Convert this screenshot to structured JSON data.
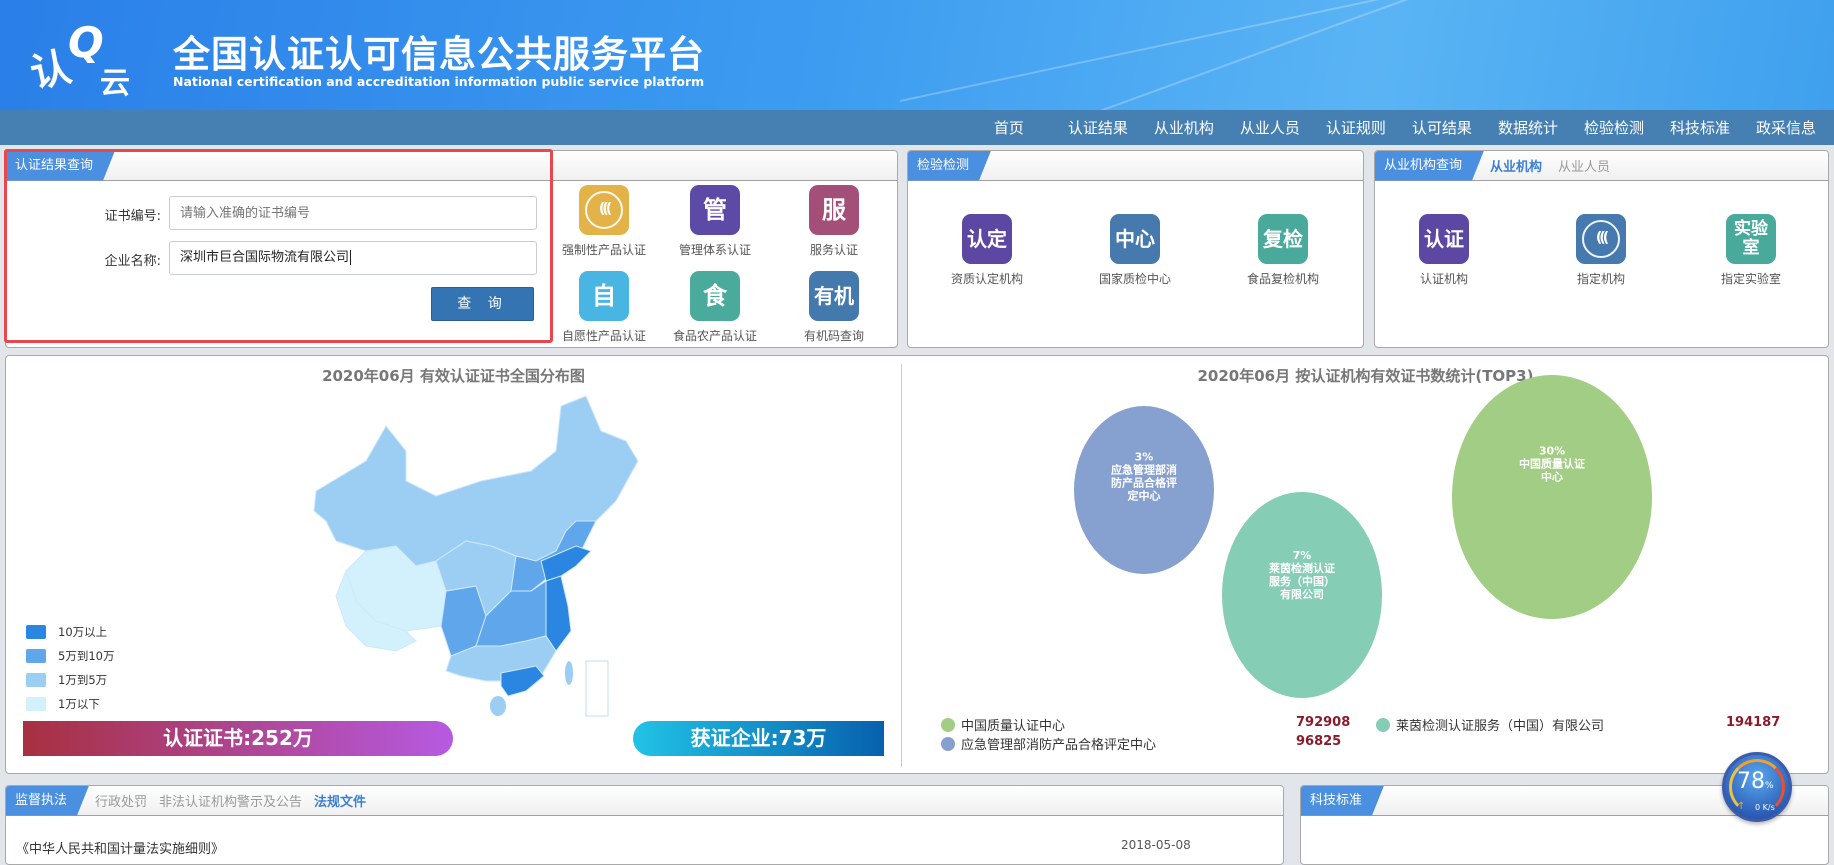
{
  "header": {
    "logo_text": "认云",
    "title": "全国认证认可信息公共服务平台",
    "subtitle": "National certification and accreditation information public service platform"
  },
  "nav": [
    "首页",
    "认证结果",
    "从业机构",
    "从业人员",
    "认证规则",
    "认可结果",
    "数据统计",
    "检验检测",
    "科技标准",
    "政采信息"
  ],
  "query": {
    "tab": "认证结果查询",
    "cert_label": "证书编号:",
    "cert_placeholder": "请输入准确的证书编号",
    "cert_value": "",
    "company_label": "企业名称:",
    "company_value": "深圳市巨合国际物流有限公司",
    "search_button": "查 询",
    "icons": [
      {
        "glyph": "CCC",
        "label": "强制性产品认证",
        "color": "#e3b34a"
      },
      {
        "glyph": "管",
        "label": "管理体系认证",
        "color": "#5c4aa6"
      },
      {
        "glyph": "服",
        "label": "服务认证",
        "color": "#a44f78"
      },
      {
        "glyph": "自",
        "label": "自愿性产品认证",
        "color": "#48b5e3"
      },
      {
        "glyph": "食",
        "label": "食品农产品认证",
        "color": "#4aaa9c"
      },
      {
        "glyph": "有机",
        "label": "有机码查询",
        "color": "#4479ad"
      }
    ]
  },
  "inspection": {
    "tab": "检验检测",
    "icons": [
      {
        "glyph": "认定",
        "label": "资质认定机构",
        "color": "#5c47a2"
      },
      {
        "glyph": "中心",
        "label": "国家质检中心",
        "color": "#4679ad"
      },
      {
        "glyph": "复检",
        "label": "食品复检机构",
        "color": "#49aa9b"
      }
    ]
  },
  "org": {
    "tab": "从业机构查询",
    "subtabs": [
      "从业机构",
      "从业人员"
    ],
    "icons": [
      {
        "glyph": "认证",
        "label": "认证机构",
        "color": "#5c47a2"
      },
      {
        "glyph": "CCC",
        "label": "指定机构",
        "color": "#4679ad"
      },
      {
        "glyph": "实验室",
        "label": "指定实验室",
        "color": "#49aa9b"
      }
    ]
  },
  "map": {
    "title": "2020年06月  有效认证证书全国分布图",
    "legend": [
      {
        "label": "10万以上",
        "color": "#2a86e0"
      },
      {
        "label": "5万到10万",
        "color": "#60a6ea"
      },
      {
        "label": "1万到5万",
        "color": "#9ccef4"
      },
      {
        "label": "1万以下",
        "color": "#d3f1fc"
      }
    ],
    "cert_total": "认证证书:252万",
    "company_total": "获证企业:73万"
  },
  "chart_data": {
    "type": "bubble",
    "title": "2020年06月   按认证机构有效证书数统计(TOP3)",
    "series": [
      {
        "name": "中国质量认证中心",
        "value": 792908,
        "percent": "30%",
        "bubble_label": "中国质量认证中心",
        "color": "#a2cd85"
      },
      {
        "name": "莱茵检测认证服务（中国）有限公司",
        "value": 194187,
        "percent": "7%",
        "bubble_label": "莱茵检测认证服务（中国）有限公司",
        "color": "#86cdb5"
      },
      {
        "name": "应急管理部消防产品合格评定中心",
        "value": 96825,
        "percent": "3%",
        "bubble_label": "应急管理部消防产品合格评定中心",
        "color": "#86a0cf"
      }
    ],
    "legend": "bottom"
  },
  "bottom": {
    "tabs": [
      "监督执法",
      "行政处罚",
      "非法认证机构警示及公告",
      "法规文件"
    ],
    "row_title": "《中华人民共和国计量法实施细则》",
    "row_date": "2018-05-08",
    "right_tab": "科技标准"
  },
  "gauge": {
    "percent": "78",
    "unit": "%",
    "speed": "0 K/s"
  }
}
